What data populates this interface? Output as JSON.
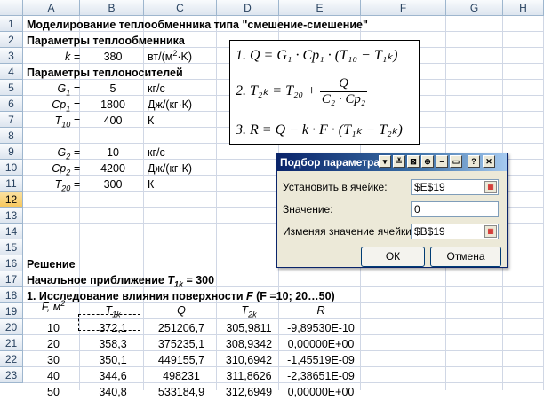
{
  "columns": [
    "A",
    "B",
    "C",
    "D",
    "E",
    "F",
    "G",
    "H"
  ],
  "rows": [
    "1",
    "2",
    "3",
    "4",
    "5",
    "6",
    "7",
    "8",
    "9",
    "10",
    "11",
    "12",
    "13",
    "14",
    "15",
    "16",
    "17",
    "18",
    "19",
    "20",
    "21",
    "22",
    "23"
  ],
  "selected_row": "12",
  "title": "Моделирование теплообменника типа \"смешение-смешение\"",
  "params_hx": "Параметры теплообменника",
  "k_label": "k =",
  "k_value": "380",
  "k_unit_a": "вт/(м",
  "k_unit_sup": "2",
  "k_unit_b": "·K)",
  "params_fluids": "Параметры теплоносителей",
  "fluid1": [
    {
      "label": "G",
      "sub": "1",
      "eq": " =",
      "value": "5",
      "unit": "кг/с"
    },
    {
      "label": "Cp",
      "sub": "1",
      "eq": " =",
      "value": "1800",
      "unit": "Дж/(кг·К)"
    },
    {
      "label": "T",
      "sub": "10",
      "eq": " =",
      "value": "400",
      "unit": "К"
    }
  ],
  "fluid2": [
    {
      "label": "G",
      "sub": "2",
      "eq": " =",
      "value": "10",
      "unit": "кг/с"
    },
    {
      "label": "Cp",
      "sub": "2",
      "eq": " =",
      "value": "4200",
      "unit": "Дж/(кг·К)"
    },
    {
      "label": "T",
      "sub": "20",
      "eq": " =",
      "value": "300",
      "unit": "К"
    }
  ],
  "solution": "Решение",
  "initial_a": "Начальное приближение ",
  "initial_t": "T",
  "initial_sub": "1k",
  "initial_b": " = 300",
  "study_a": "1. Исследование влияния поверхности ",
  "study_f": "F",
  "study_b": "  (F =10; 20…50)",
  "table_headers": {
    "f": "F, м",
    "f_sup": "2",
    "t1": "T",
    "t1_sub": "1k",
    "q": "Q",
    "t2": "T",
    "t2_sub": "2k",
    "r": "R"
  },
  "table_rows": [
    [
      "10",
      "372,1",
      "251206,7",
      "305,9811",
      "-9,89530E-10"
    ],
    [
      "20",
      "358,3",
      "375235,1",
      "308,9342",
      "0,00000E+00"
    ],
    [
      "30",
      "350,1",
      "449155,7",
      "310,6942",
      "-1,45519E-09"
    ],
    [
      "40",
      "344,6",
      "498231",
      "311,8626",
      "-2,38651E-09"
    ],
    [
      "50",
      "340,8",
      "533184,9",
      "312,6949",
      "0,00000E+00"
    ]
  ],
  "formulas": {
    "f1": "1. Q = G₁ · Cp₁ · (T₁₀ − T₁ₖ)",
    "f2_a": "2. T₂ₖ = T₂₀ + ",
    "f2_num": "Q",
    "f2_den": "C₂ · Cp₂",
    "f3": "3. R = Q − k · F · (T₁ₖ − T₂ₖ)"
  },
  "dialog": {
    "title": "Подбор параметра",
    "set_cell_label": "Установить в ячейке:",
    "set_cell_value": "$E$19",
    "value_label": "Значение:",
    "value_value": "0",
    "changing_label": "Изменяя значение ячейки:",
    "changing_value": "$B$19",
    "ok": "ОК",
    "cancel": "Отмена"
  }
}
